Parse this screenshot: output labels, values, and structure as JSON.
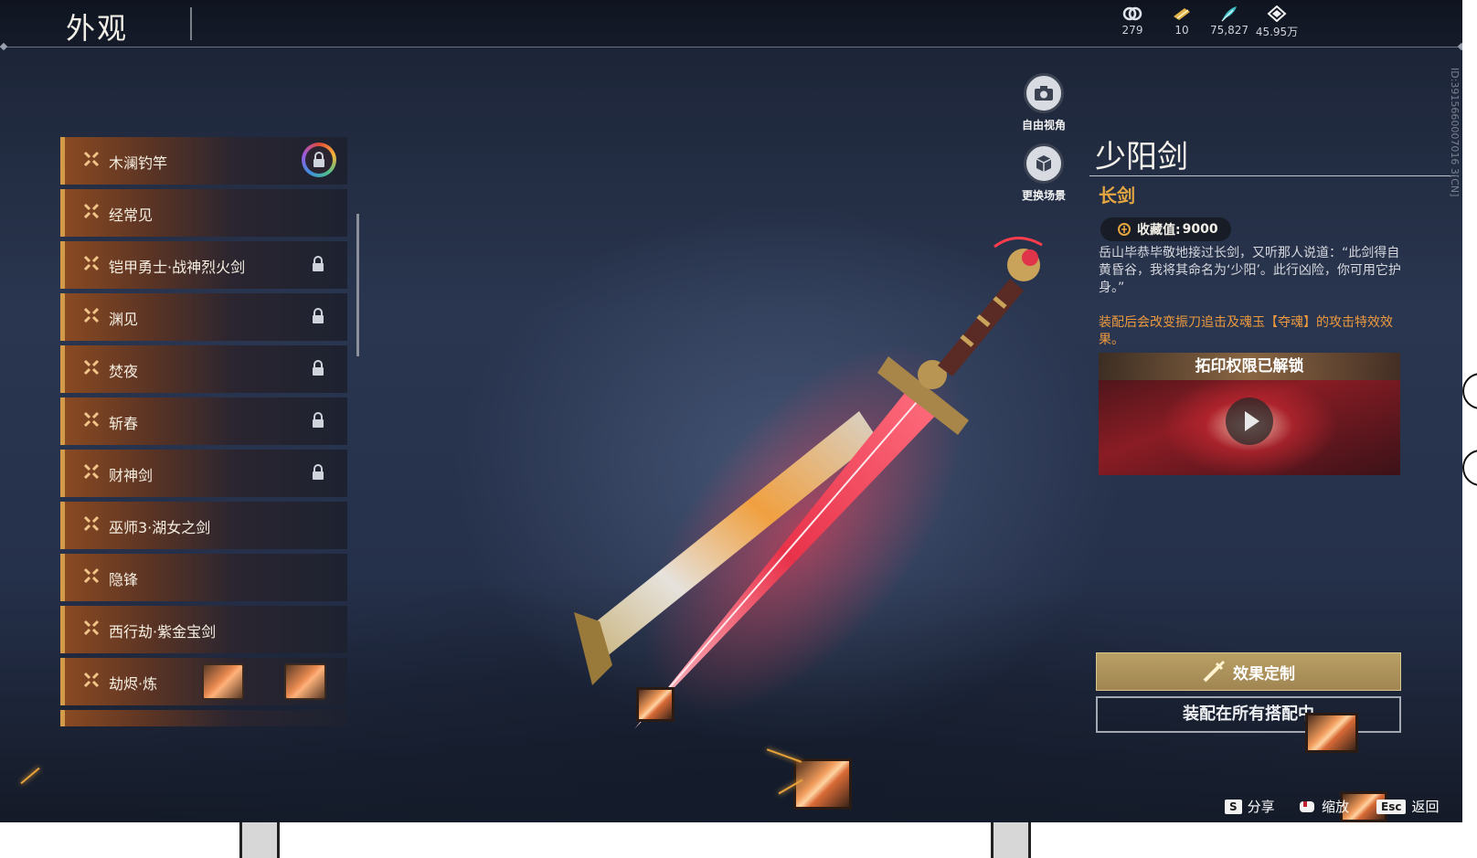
{
  "header": {
    "title": "外观",
    "currencies": [
      {
        "icon": "spirit-icon",
        "value": "279"
      },
      {
        "icon": "ticket-icon",
        "value": "10"
      },
      {
        "icon": "feather-icon",
        "value": "75,827"
      },
      {
        "icon": "gem-icon",
        "value": "45.95万"
      }
    ]
  },
  "skin_list": {
    "items": [
      {
        "label": "木澜钓竿",
        "locked": true,
        "special_lock": true
      },
      {
        "label": "经常见",
        "locked": false
      },
      {
        "label": "铠甲勇士·战神烈火剑",
        "locked": true
      },
      {
        "label": "渊见",
        "locked": true
      },
      {
        "label": "焚夜",
        "locked": true
      },
      {
        "label": "斩春",
        "locked": true
      },
      {
        "label": "财神剑",
        "locked": true
      },
      {
        "label": "巫师3·湖女之剑",
        "locked": false
      },
      {
        "label": "隐锋",
        "locked": false
      },
      {
        "label": "西行劫·紫金宝剑",
        "locked": false
      },
      {
        "label": "劫烬·炼",
        "locked": false
      }
    ]
  },
  "side_buttons": {
    "free_view": "自由视角",
    "change_scene": "更换场景"
  },
  "detail": {
    "name": "少阳剑",
    "type": "长剑",
    "collect_label": "收藏值:",
    "collect_value": "9000",
    "description": "岳山毕恭毕敬地接过长剑，又听那人说道：“此剑得自黄昏谷，我将其命名为‘少阳’。此行凶险，你可用它护身。”",
    "effect": "装配后会改变振刀追击及魂玉【夺魂】的攻击特效效果。",
    "video_title": "拓印权限已解锁",
    "effect_button": "效果定制",
    "equip_button": "装配在所有搭配中",
    "vertical_id": "ID:3915660007016 3[CN]"
  },
  "hints": {
    "share_key": "S",
    "share_label": "分享",
    "zoom_label": "缩放",
    "back_key": "Esc",
    "back_label": "返回"
  },
  "colors": {
    "accent_gold": "#e4a640",
    "effect_orange": "#ee9a3e",
    "item_border": "#d39a4a"
  }
}
